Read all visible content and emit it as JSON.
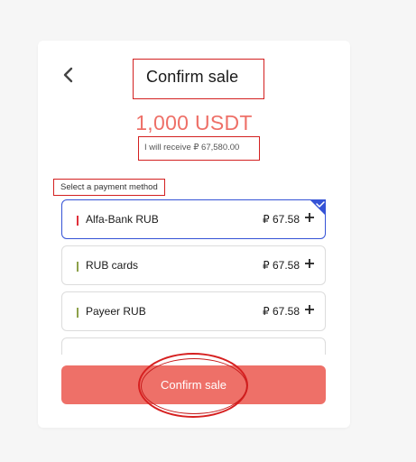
{
  "header": {
    "title": "Confirm sale"
  },
  "amount": {
    "text": "1,000 USDT",
    "receive_text": "I will receive ₽ 67,580.00"
  },
  "payment": {
    "label": "Select a payment method",
    "options": [
      {
        "name": "Alfa-Bank RUB",
        "rate": "₽ 67.58",
        "bar_color": "#e0303a",
        "selected": true
      },
      {
        "name": "RUB cards",
        "rate": "₽ 67.58",
        "bar_color": "#8da14a",
        "selected": false
      },
      {
        "name": "Payeer RUB",
        "rate": "₽ 67.58",
        "bar_color": "#8da14a",
        "selected": false
      }
    ]
  },
  "actions": {
    "confirm_label": "Confirm sale"
  },
  "colors": {
    "accent": "#ee7068",
    "selected_border": "#3553d6",
    "annotation": "#d32020"
  },
  "icons": {
    "back": "chevron-left-icon",
    "plus": "plus-icon",
    "check": "check-corner-icon"
  }
}
